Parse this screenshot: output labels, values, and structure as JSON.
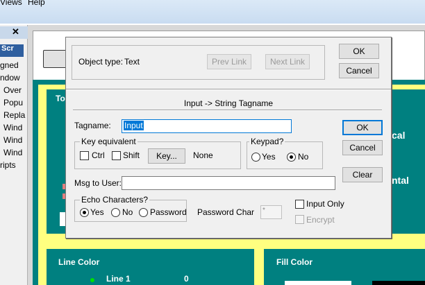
{
  "app": {
    "menu": [
      {
        "label": "Views"
      },
      {
        "label": "Help"
      }
    ],
    "left_panel": {
      "close_glyph": "✕",
      "tab_label": "Scr",
      "items": [
        "gned",
        "ndow",
        "Over",
        "Popu",
        "Repla",
        "Wind",
        "Wind",
        "Wind",
        "ripts"
      ]
    },
    "canvas": {
      "panel_top_left_fragment": "To",
      "right_fragment_1": "cal",
      "right_fragment_2": "ntal",
      "line_color_label": "Line Color",
      "fill_color_label": "Fill Color",
      "line1_label": "Line 1",
      "line1_value": "0"
    }
  },
  "dialog": {
    "object_type_label": "Object type:",
    "object_type_value": "Text",
    "prev_link": "Prev Link",
    "next_link": "Next Link",
    "ok_top": "OK",
    "cancel_top": "Cancel",
    "section_title": "Input -> String Tagname",
    "tagname_label": "Tagname:",
    "tagname_value": "Input",
    "ok": "OK",
    "cancel": "Cancel",
    "clear": "Clear",
    "key_equivalent": {
      "title": "Key equivalent",
      "ctrl": "Ctrl",
      "ctrl_checked": false,
      "shift": "Shift",
      "shift_checked": false,
      "key_button": "Key...",
      "key_value": "None"
    },
    "keypad": {
      "title": "Keypad?",
      "yes": "Yes",
      "no": "No",
      "selected": "No"
    },
    "msg_to_user_label": "Msg to User:",
    "msg_to_user_value": "",
    "echo_characters": {
      "title": "Echo Characters?",
      "yes": "Yes",
      "no": "No",
      "password": "Password",
      "selected": "Yes"
    },
    "password_char_label": "Password Char",
    "password_char_value": "*",
    "input_only": "Input Only",
    "input_only_checked": false,
    "encrypt": "Encrypt",
    "encrypt_checked": false
  },
  "colors": {
    "teal": "#008080",
    "yellow": "#ffff80",
    "selection": "#0078d7"
  }
}
